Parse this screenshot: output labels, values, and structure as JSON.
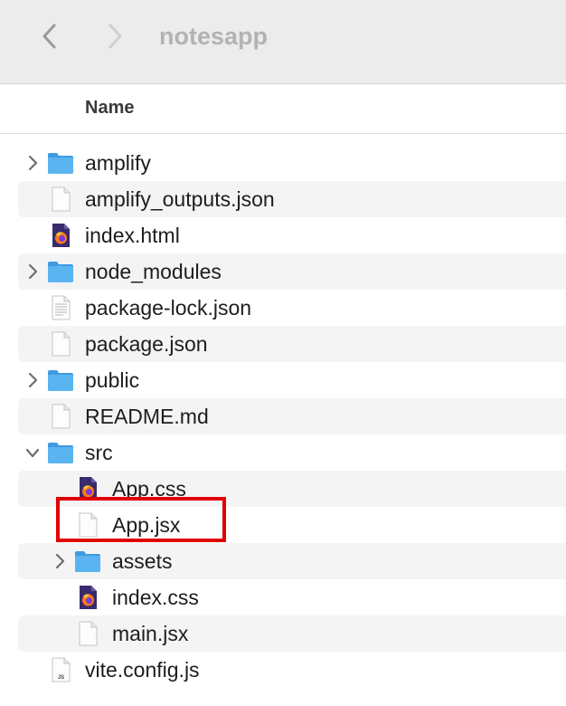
{
  "window": {
    "title": "notesapp",
    "back_icon": "chevron-left-icon",
    "forward_icon": "chevron-right-icon"
  },
  "header": {
    "name_column": "Name"
  },
  "files": [
    {
      "label": "amplify",
      "type": "folder",
      "depth": 0,
      "expanded": false
    },
    {
      "label": "amplify_outputs.json",
      "type": "file",
      "depth": 0
    },
    {
      "label": "index.html",
      "type": "firefox-doc",
      "depth": 0
    },
    {
      "label": "node_modules",
      "type": "folder",
      "depth": 0,
      "expanded": false
    },
    {
      "label": "package-lock.json",
      "type": "text-doc",
      "depth": 0
    },
    {
      "label": "package.json",
      "type": "file",
      "depth": 0
    },
    {
      "label": "public",
      "type": "folder",
      "depth": 0,
      "expanded": false
    },
    {
      "label": "README.md",
      "type": "file",
      "depth": 0
    },
    {
      "label": "src",
      "type": "folder",
      "depth": 0,
      "expanded": true
    },
    {
      "label": "App.css",
      "type": "firefox-doc",
      "depth": 1
    },
    {
      "label": "App.jsx",
      "type": "file",
      "depth": 1,
      "highlighted": true
    },
    {
      "label": "assets",
      "type": "folder",
      "depth": 1,
      "expanded": false
    },
    {
      "label": "index.css",
      "type": "firefox-doc",
      "depth": 1
    },
    {
      "label": "main.jsx",
      "type": "file",
      "depth": 1
    },
    {
      "label": "vite.config.js",
      "type": "js-doc",
      "depth": 0,
      "badge": "JS"
    }
  ],
  "colors": {
    "highlight": "#e00000",
    "folder": "#5ab4f0",
    "firefox_bg": "#3a2a6e"
  }
}
